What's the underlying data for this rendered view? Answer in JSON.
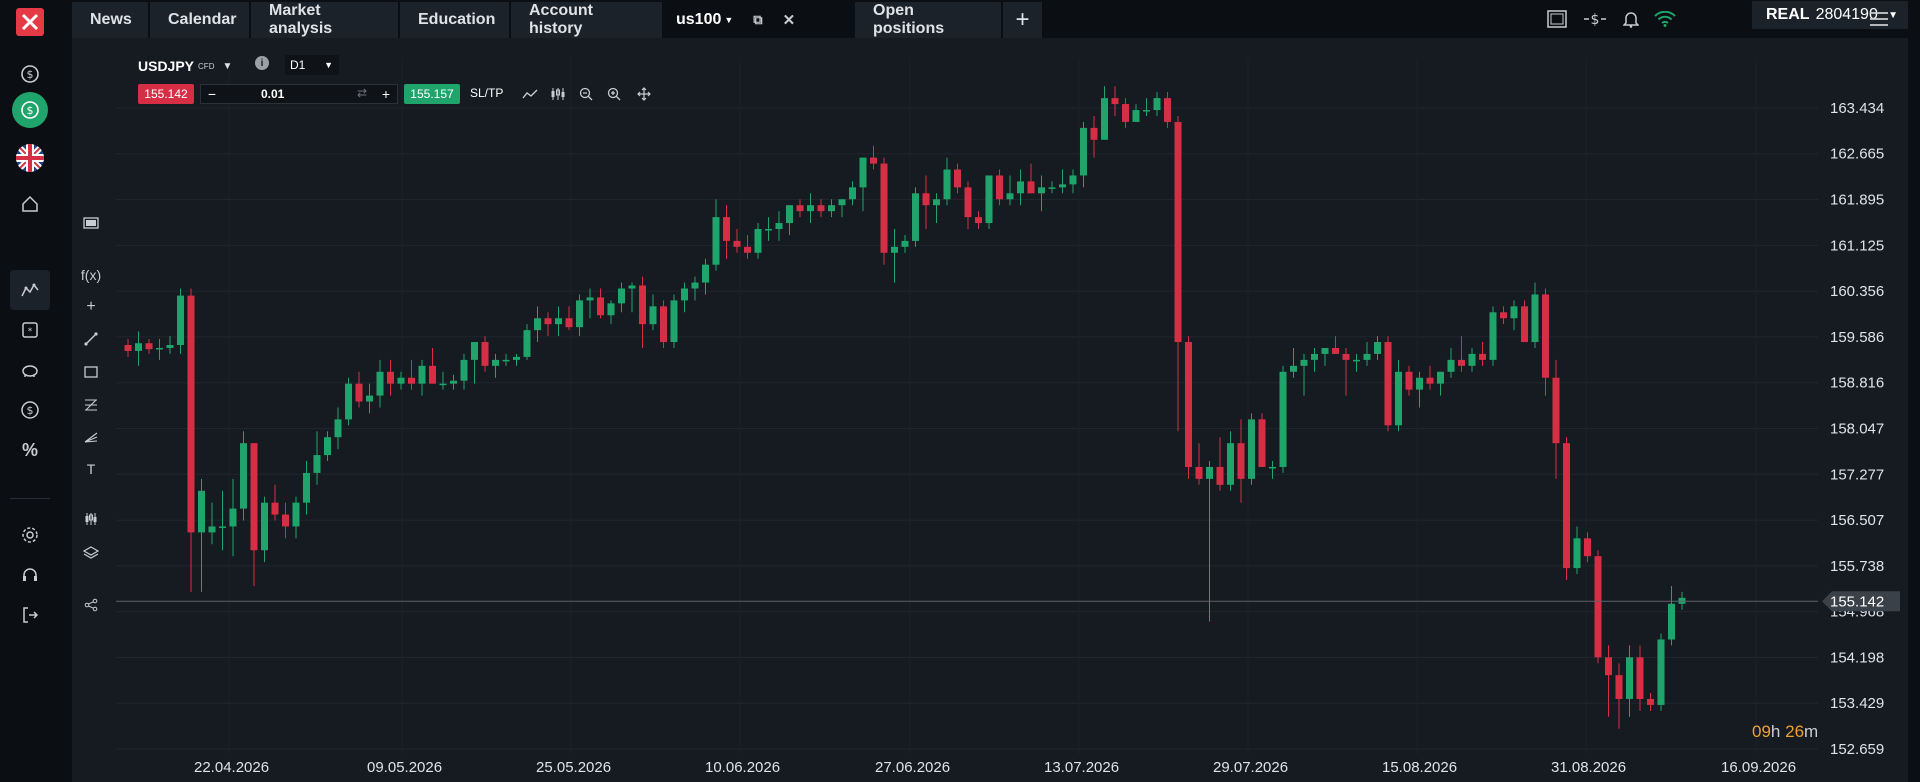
{
  "nav": {
    "tabs": [
      {
        "label": "News"
      },
      {
        "label": "Calendar"
      },
      {
        "label": "Market analysis"
      },
      {
        "label": "Education"
      },
      {
        "label": "Account history"
      },
      {
        "label": "us100"
      },
      {
        "label": "Open positions"
      }
    ],
    "add_tab": "+"
  },
  "account": {
    "type": "REAL",
    "number": "2804190"
  },
  "instrument": {
    "symbol": "USDJPY",
    "kind": "CFD",
    "timeframe": "D1",
    "sell_price": "155.142",
    "buy_price": "155.157",
    "quantity": "0.01",
    "sltp_label": "SL/TP",
    "info_label": "i"
  },
  "timer": {
    "hours": "09",
    "h": "h",
    "minutes": "26",
    "m": "m"
  },
  "chart_data": {
    "type": "candlestick",
    "current_price": 155.142,
    "y_ticks": [
      "163.434",
      "162.665",
      "161.895",
      "161.125",
      "160.356",
      "159.586",
      "158.816",
      "158.047",
      "157.277",
      "156.507",
      "155.738",
      "154.968",
      "154.198",
      "153.429",
      "152.659"
    ],
    "y_range": [
      152.659,
      163.434
    ],
    "x_ticks": [
      "22.04.2026",
      "09.05.2026",
      "25.05.2026",
      "10.06.2026",
      "27.06.2026",
      "13.07.2026",
      "29.07.2026",
      "15.08.2026",
      "31.08.2026",
      "16.09.2026"
    ],
    "grid": true,
    "candles": [
      [
        159.45,
        159.55,
        159.25,
        159.35
      ],
      [
        159.35,
        159.68,
        159.1,
        159.48
      ],
      [
        159.48,
        159.55,
        159.3,
        159.38
      ],
      [
        159.38,
        159.55,
        159.2,
        159.4
      ],
      [
        159.4,
        159.6,
        159.3,
        159.45
      ],
      [
        159.45,
        160.4,
        159.3,
        160.28
      ],
      [
        160.28,
        160.4,
        155.3,
        156.3
      ],
      [
        156.3,
        157.2,
        155.3,
        157.0
      ],
      [
        156.3,
        156.8,
        156.1,
        156.4
      ],
      [
        156.4,
        157.0,
        156.0,
        156.4
      ],
      [
        156.4,
        157.2,
        155.9,
        156.7
      ],
      [
        156.7,
        158.0,
        156.5,
        157.8
      ],
      [
        157.8,
        157.8,
        155.4,
        156.0
      ],
      [
        156.0,
        156.9,
        155.8,
        156.8
      ],
      [
        156.8,
        157.1,
        156.5,
        156.6
      ],
      [
        156.6,
        156.8,
        156.2,
        156.4
      ],
      [
        156.4,
        156.9,
        156.2,
        156.8
      ],
      [
        156.8,
        157.5,
        156.6,
        157.3
      ],
      [
        157.3,
        158.0,
        157.1,
        157.6
      ],
      [
        157.6,
        158.0,
        157.5,
        157.9
      ],
      [
        157.9,
        158.4,
        157.7,
        158.2
      ],
      [
        158.2,
        158.9,
        158.1,
        158.8
      ],
      [
        158.8,
        159.0,
        158.4,
        158.5
      ],
      [
        158.5,
        158.8,
        158.3,
        158.6
      ],
      [
        158.6,
        159.2,
        158.4,
        159.0
      ],
      [
        159.0,
        159.2,
        158.6,
        158.8
      ],
      [
        158.8,
        159.0,
        158.7,
        158.9
      ],
      [
        158.9,
        159.2,
        158.7,
        158.8
      ],
      [
        158.8,
        159.2,
        158.6,
        159.1
      ],
      [
        159.1,
        159.4,
        158.8,
        158.8
      ],
      [
        158.8,
        159.0,
        158.7,
        158.8
      ],
      [
        158.8,
        158.95,
        158.7,
        158.85
      ],
      [
        158.85,
        159.3,
        158.7,
        159.2
      ],
      [
        159.2,
        159.5,
        158.8,
        159.5
      ],
      [
        159.5,
        159.6,
        159.0,
        159.1
      ],
      [
        159.1,
        159.3,
        158.9,
        159.2
      ],
      [
        159.2,
        159.3,
        159.1,
        159.2
      ],
      [
        159.2,
        159.3,
        159.1,
        159.25
      ],
      [
        159.25,
        159.8,
        159.2,
        159.7
      ],
      [
        159.7,
        160.1,
        159.5,
        159.9
      ],
      [
        159.9,
        160.0,
        159.6,
        159.8
      ],
      [
        159.8,
        160.1,
        159.6,
        159.9
      ],
      [
        159.9,
        160.1,
        159.7,
        159.75
      ],
      [
        159.75,
        160.3,
        159.6,
        160.2
      ],
      [
        160.2,
        160.4,
        159.9,
        160.25
      ],
      [
        160.25,
        160.4,
        159.9,
        159.95
      ],
      [
        159.95,
        160.2,
        159.8,
        160.15
      ],
      [
        160.15,
        160.5,
        160.0,
        160.4
      ],
      [
        160.4,
        160.5,
        160.0,
        160.45
      ],
      [
        160.45,
        160.6,
        159.4,
        159.8
      ],
      [
        159.8,
        160.3,
        159.7,
        160.1
      ],
      [
        160.1,
        160.2,
        159.4,
        159.5
      ],
      [
        159.5,
        160.3,
        159.4,
        160.2
      ],
      [
        160.2,
        160.5,
        160.0,
        160.4
      ],
      [
        160.4,
        160.6,
        160.2,
        160.5
      ],
      [
        160.5,
        160.9,
        160.3,
        160.8
      ],
      [
        160.8,
        161.9,
        160.7,
        161.6
      ],
      [
        161.6,
        161.8,
        160.9,
        161.2
      ],
      [
        161.2,
        161.4,
        161.0,
        161.1
      ],
      [
        161.1,
        161.3,
        160.9,
        161.0
      ],
      [
        161.0,
        161.5,
        160.9,
        161.4
      ],
      [
        161.4,
        161.6,
        161.2,
        161.4
      ],
      [
        161.4,
        161.7,
        161.2,
        161.5
      ],
      [
        161.5,
        161.8,
        161.3,
        161.8
      ],
      [
        161.8,
        161.9,
        161.6,
        161.7
      ],
      [
        161.7,
        162.0,
        161.5,
        161.8
      ],
      [
        161.8,
        161.9,
        161.6,
        161.7
      ],
      [
        161.7,
        161.9,
        161.6,
        161.8
      ],
      [
        161.8,
        161.9,
        161.6,
        161.9
      ],
      [
        161.9,
        162.2,
        161.8,
        162.1
      ],
      [
        162.1,
        162.6,
        161.7,
        162.6
      ],
      [
        162.6,
        162.8,
        162.4,
        162.5
      ],
      [
        162.5,
        162.6,
        160.8,
        161.0
      ],
      [
        161.0,
        161.4,
        160.5,
        161.1
      ],
      [
        161.1,
        161.3,
        161.0,
        161.2
      ],
      [
        161.2,
        162.1,
        161.1,
        162.0
      ],
      [
        162.0,
        162.3,
        161.4,
        161.8
      ],
      [
        161.8,
        162.0,
        161.5,
        161.9
      ],
      [
        161.9,
        162.6,
        161.8,
        162.4
      ],
      [
        162.4,
        162.5,
        162.0,
        162.1
      ],
      [
        162.1,
        162.2,
        161.4,
        161.6
      ],
      [
        161.6,
        161.7,
        161.4,
        161.5
      ],
      [
        161.5,
        162.1,
        161.4,
        162.3
      ],
      [
        162.3,
        162.4,
        161.8,
        161.9
      ],
      [
        161.9,
        162.3,
        161.8,
        162.0
      ],
      [
        162.0,
        162.4,
        161.8,
        162.2
      ],
      [
        162.2,
        162.5,
        162.0,
        162.0
      ],
      [
        162.0,
        162.3,
        161.7,
        162.1
      ],
      [
        162.1,
        162.2,
        162.0,
        162.1
      ],
      [
        162.1,
        162.4,
        162.0,
        162.15
      ],
      [
        162.15,
        162.4,
        162.0,
        162.3
      ],
      [
        162.3,
        163.2,
        162.1,
        163.1
      ],
      [
        163.1,
        163.3,
        162.6,
        162.9
      ],
      [
        162.9,
        163.8,
        162.9,
        163.6
      ],
      [
        163.6,
        163.8,
        163.3,
        163.5
      ],
      [
        163.5,
        163.6,
        163.1,
        163.2
      ],
      [
        163.2,
        163.5,
        163.2,
        163.4
      ],
      [
        163.4,
        163.6,
        163.3,
        163.4
      ],
      [
        163.4,
        163.7,
        163.3,
        163.6
      ],
      [
        163.6,
        163.7,
        163.1,
        163.2
      ],
      [
        163.2,
        163.3,
        158.0,
        159.5
      ],
      [
        159.5,
        159.6,
        157.2,
        157.4
      ],
      [
        157.4,
        157.8,
        157.1,
        157.2
      ],
      [
        157.2,
        157.5,
        154.8,
        157.4
      ],
      [
        157.4,
        157.9,
        157.0,
        157.1
      ],
      [
        157.1,
        158.0,
        157.0,
        157.8
      ],
      [
        157.8,
        158.2,
        156.8,
        157.2
      ],
      [
        157.2,
        158.3,
        157.1,
        158.2
      ],
      [
        158.2,
        158.3,
        157.4,
        157.4
      ],
      [
        157.4,
        157.5,
        157.2,
        157.4
      ],
      [
        157.4,
        159.1,
        157.3,
        159.0
      ],
      [
        159.0,
        159.4,
        158.9,
        159.1
      ],
      [
        159.1,
        159.3,
        158.6,
        159.2
      ],
      [
        159.2,
        159.4,
        159.0,
        159.3
      ],
      [
        159.3,
        159.4,
        159.1,
        159.4
      ],
      [
        159.4,
        159.6,
        159.3,
        159.3
      ],
      [
        159.3,
        159.4,
        158.6,
        159.2
      ],
      [
        159.2,
        159.3,
        159.0,
        159.2
      ],
      [
        159.2,
        159.5,
        159.1,
        159.3
      ],
      [
        159.3,
        159.6,
        159.2,
        159.5
      ],
      [
        159.5,
        159.6,
        158.0,
        158.1
      ],
      [
        158.1,
        159.2,
        158.0,
        159.0
      ],
      [
        159.0,
        159.1,
        158.6,
        158.7
      ],
      [
        158.7,
        159.0,
        158.4,
        158.9
      ],
      [
        158.9,
        159.1,
        158.7,
        158.8
      ],
      [
        158.8,
        159.0,
        158.6,
        159.0
      ],
      [
        159.0,
        159.4,
        158.9,
        159.2
      ],
      [
        159.2,
        159.6,
        159.0,
        159.1
      ],
      [
        159.1,
        159.4,
        159.0,
        159.3
      ],
      [
        159.3,
        159.5,
        159.1,
        159.2
      ],
      [
        159.2,
        160.1,
        159.1,
        160.0
      ],
      [
        160.0,
        160.1,
        159.8,
        159.9
      ],
      [
        159.9,
        160.2,
        159.7,
        160.1
      ],
      [
        160.1,
        160.2,
        159.5,
        159.5
      ],
      [
        159.5,
        160.5,
        159.4,
        160.3
      ],
      [
        160.3,
        160.4,
        158.6,
        158.9
      ],
      [
        158.9,
        159.2,
        157.2,
        157.8
      ],
      [
        157.8,
        157.9,
        155.5,
        155.7
      ],
      [
        155.7,
        156.4,
        155.6,
        156.2
      ],
      [
        156.2,
        156.3,
        155.8,
        155.9
      ],
      [
        155.9,
        156.0,
        154.1,
        154.2
      ],
      [
        154.2,
        154.4,
        153.2,
        153.9
      ],
      [
        153.9,
        154.1,
        153.0,
        153.5
      ],
      [
        153.5,
        154.4,
        153.2,
        154.2
      ],
      [
        154.2,
        154.4,
        153.3,
        153.5
      ],
      [
        153.5,
        153.6,
        153.3,
        153.4
      ],
      [
        153.4,
        154.6,
        153.3,
        154.5
      ],
      [
        154.5,
        155.4,
        154.4,
        155.1
      ],
      [
        155.1,
        155.3,
        155.0,
        155.2
      ]
    ]
  }
}
